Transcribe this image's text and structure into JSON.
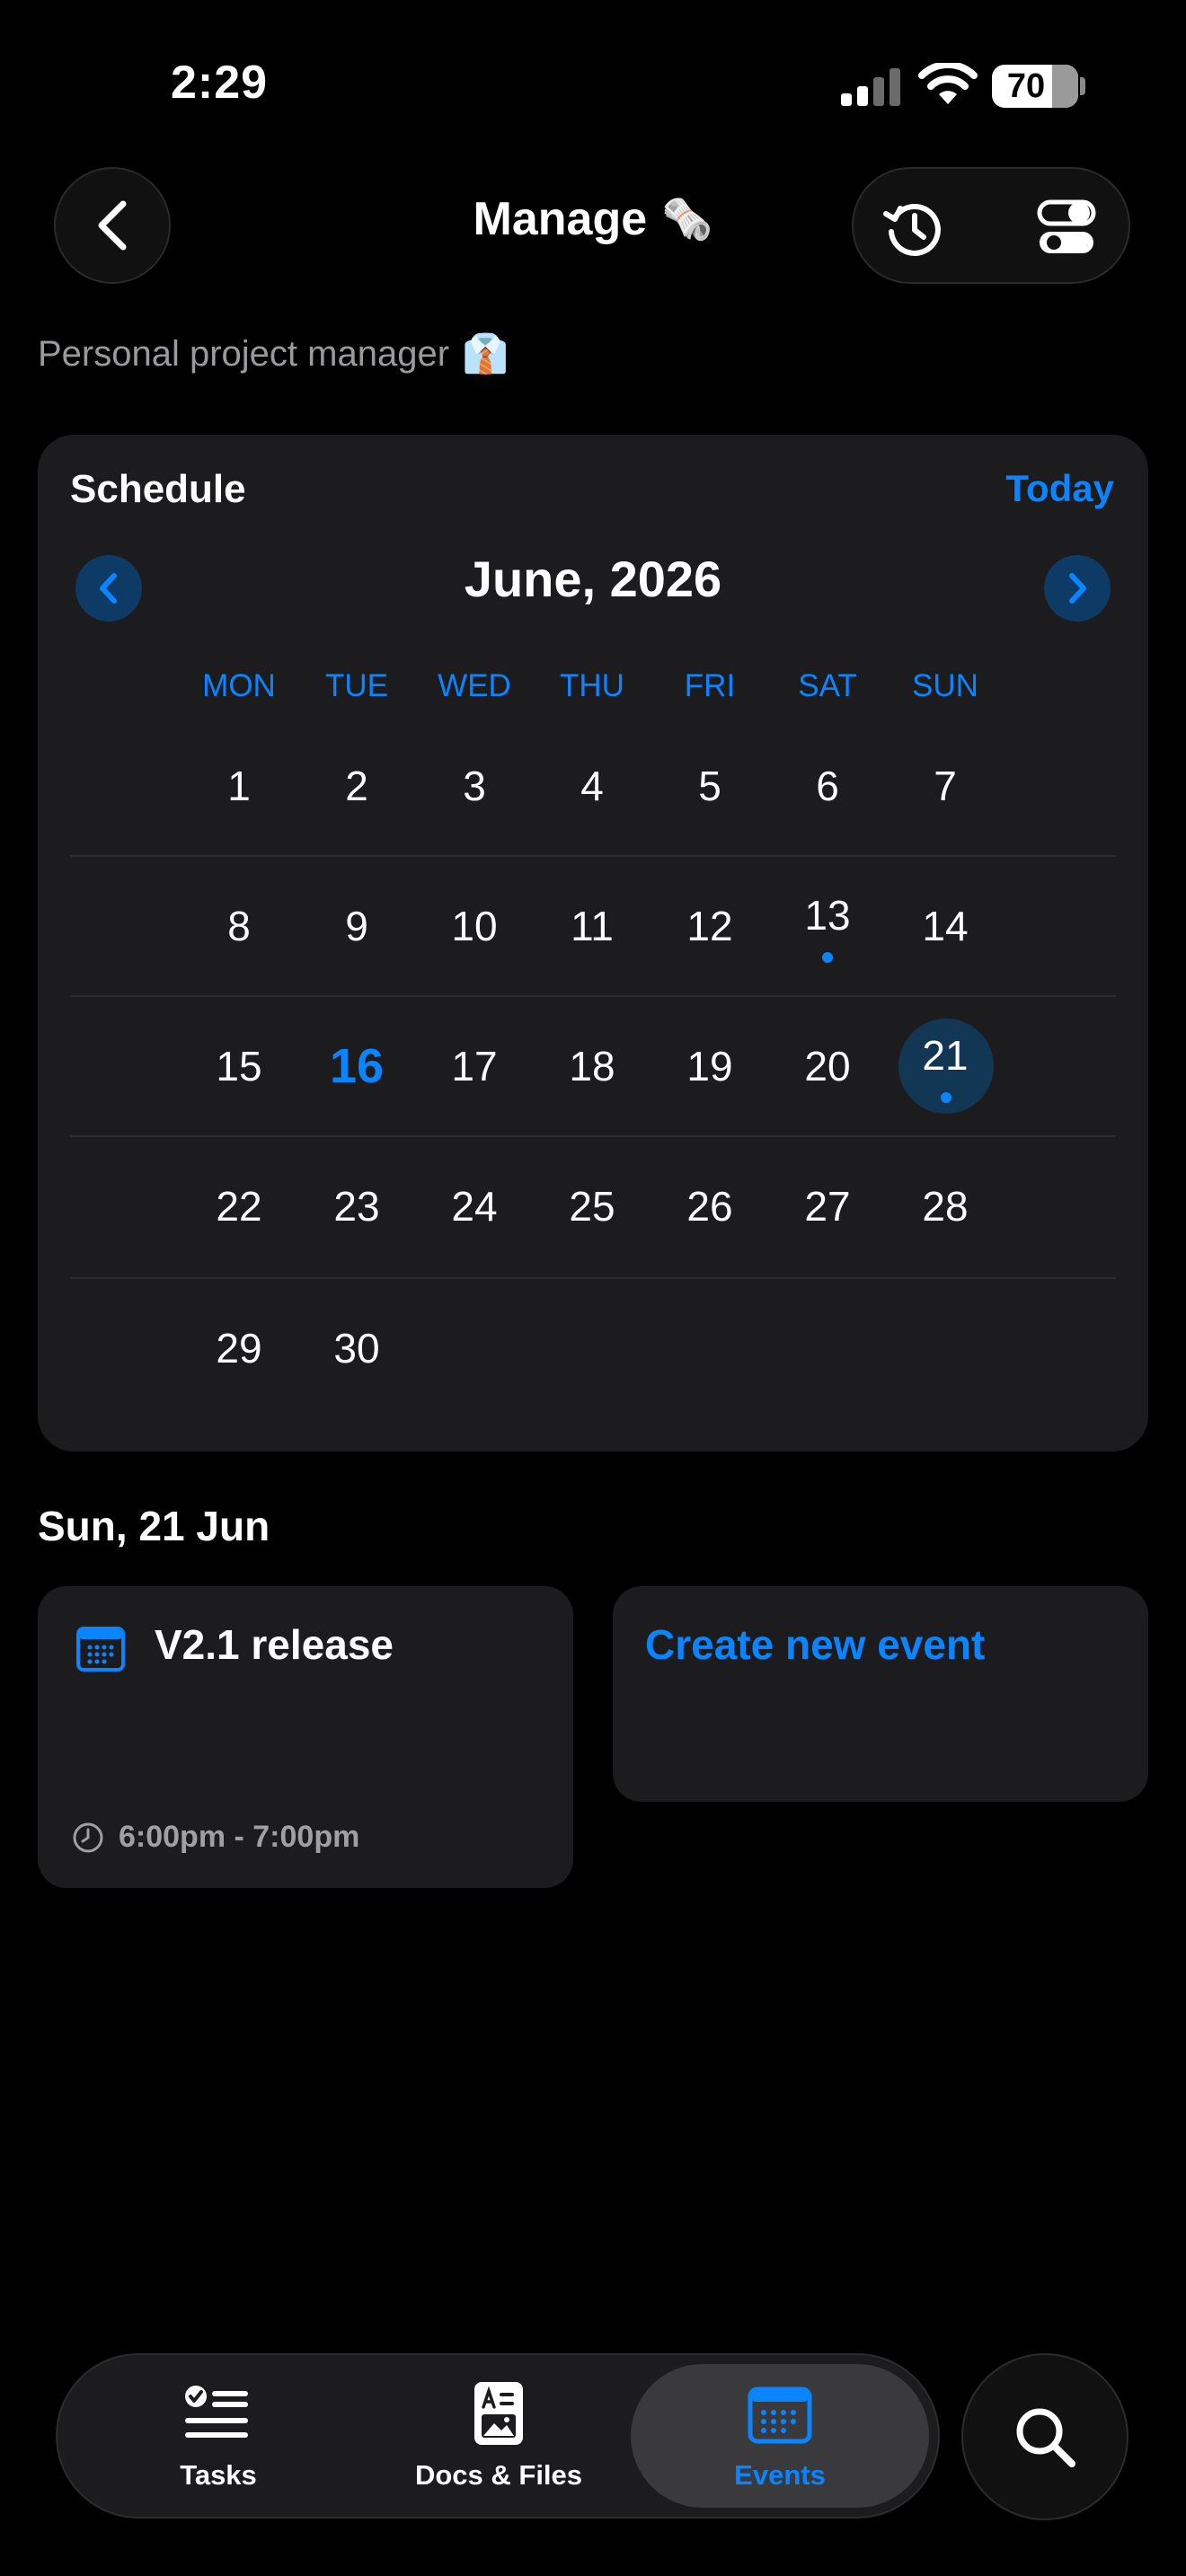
{
  "status_bar": {
    "time": "2:29",
    "battery": "70"
  },
  "header": {
    "title": "Manage",
    "title_emoji": "🗞️",
    "subtitle": "Personal project manager",
    "subtitle_emoji": "👔"
  },
  "schedule": {
    "label": "Schedule",
    "today_label": "Today",
    "month_title": "June, 2026",
    "weekdays": [
      "MON",
      "TUE",
      "WED",
      "THU",
      "FRI",
      "SAT",
      "SUN"
    ],
    "weeks": [
      [
        "1",
        "2",
        "3",
        "4",
        "5",
        "6",
        "7"
      ],
      [
        "8",
        "9",
        "10",
        "11",
        "12",
        "13",
        "14"
      ],
      [
        "15",
        "16",
        "17",
        "18",
        "19",
        "20",
        "21"
      ],
      [
        "22",
        "23",
        "24",
        "25",
        "26",
        "27",
        "28"
      ],
      [
        "29",
        "30",
        "",
        "",
        "",
        "",
        ""
      ]
    ],
    "today_day": "16",
    "selected_day": "21",
    "event_days": [
      "13",
      "21"
    ],
    "accent_color": "#0a84ff"
  },
  "events": {
    "date_heading": "Sun, 21 Jun",
    "items": [
      {
        "title": "V2.1 release",
        "time": "6:00pm - 7:00pm",
        "icon": "calendar-icon"
      }
    ],
    "create_label": "Create new event"
  },
  "tabbar": {
    "tabs": [
      {
        "label": "Tasks",
        "icon": "checklist-icon"
      },
      {
        "label": "Docs & Files",
        "icon": "document-icon"
      },
      {
        "label": "Events",
        "icon": "calendar-icon"
      }
    ],
    "active": "Events",
    "search_icon": "search-icon"
  }
}
